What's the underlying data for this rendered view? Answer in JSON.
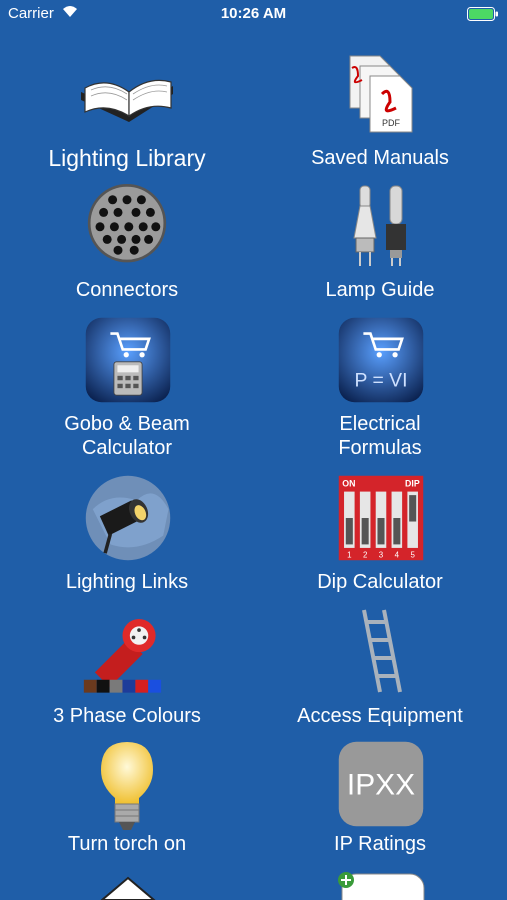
{
  "status": {
    "carrier": "Carrier",
    "time": "10:26 AM"
  },
  "tiles": [
    {
      "label": "Lighting Library",
      "icon": "book-icon"
    },
    {
      "label": "Saved Manuals",
      "icon": "pdf-documents-icon"
    },
    {
      "label": "Connectors",
      "icon": "multipin-connector-icon"
    },
    {
      "label": "Lamp Guide",
      "icon": "lamps-icon"
    },
    {
      "label": "Gobo & Beam Calculator",
      "icon": "calculator-cart-icon"
    },
    {
      "label": "Electrical Formulas",
      "icon": "pvi-cart-icon"
    },
    {
      "label": "Lighting Links",
      "icon": "spotlight-icon"
    },
    {
      "label": "Dip Calculator",
      "icon": "dip-switch-icon"
    },
    {
      "label": "3 Phase Colours",
      "icon": "three-phase-plug-icon"
    },
    {
      "label": "Access Equipment",
      "icon": "ladder-icon"
    },
    {
      "label": "Turn torch on",
      "icon": "light-bulb-icon"
    },
    {
      "label": "IP Ratings",
      "icon": "ip-rating-icon"
    }
  ],
  "dip": {
    "on": "ON",
    "dip": "DIP",
    "numbers": [
      "1",
      "2",
      "3",
      "4",
      "5"
    ]
  },
  "ip_text": "IPXX",
  "pvi_text": "P = VI",
  "pdf_text": "PDF"
}
